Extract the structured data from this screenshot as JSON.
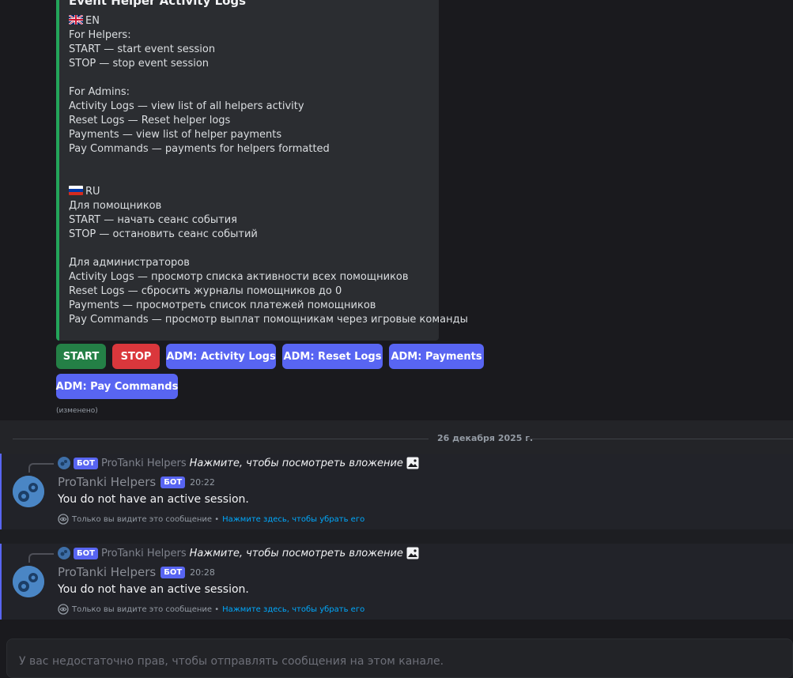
{
  "embed": {
    "title": "Event Helper Activity Logs",
    "accent_color": "#23a55a",
    "lines": [
      {
        "flag": "gb",
        "text": "EN"
      },
      {
        "text": "For Helpers:"
      },
      {
        "text": "START — start event session"
      },
      {
        "text": "STOP — stop event session"
      },
      {
        "text": ""
      },
      {
        "text": "For Admins:"
      },
      {
        "text": "Activity Logs — view list of all helpers activity"
      },
      {
        "text": "Reset Logs — Reset helper logs"
      },
      {
        "text": "Payments — view list of helper payments"
      },
      {
        "text": "Pay Commands — payments for helpers formatted"
      },
      {
        "text": ""
      },
      {
        "text": ""
      },
      {
        "flag": "ru",
        "text": "RU"
      },
      {
        "text": "Для помощников"
      },
      {
        "text": "START — начать сеанс события"
      },
      {
        "text": "STOP — остановить сеанс событий"
      },
      {
        "text": ""
      },
      {
        "text": "Для администраторов"
      },
      {
        "text": "Activity Logs — просмотр списка активности всех помощников"
      },
      {
        "text": "Reset Logs — сбросить журналы помощников до 0"
      },
      {
        "text": "Payments — просмотреть список платежей помощников"
      },
      {
        "text": "Pay Commands — просмотр выплат помощникам через игровые команды"
      }
    ]
  },
  "buttons": {
    "start": "START",
    "stop": "STOP",
    "activity_logs": "ADM: Activity Logs",
    "reset_logs": "ADM: Reset Logs",
    "payments": "ADM: Payments",
    "pay_commands": "ADM: Pay Commands"
  },
  "edited_label": "(изменено)",
  "date_divider": "26 декабря 2025 г.",
  "messages": [
    {
      "reply_bot_tag": "БОТ",
      "reply_author": "ProTanki Helpers",
      "reply_text": "Нажмите, чтобы посмотреть вложение",
      "author": "ProTanki Helpers",
      "bot_tag": "БОТ",
      "time": "20:22",
      "content": "You do not have an active session.",
      "ephemeral_note": "Только вы видите это сообщение •",
      "dismiss_link": "Нажмите здесь, чтобы убрать его"
    },
    {
      "reply_bot_tag": "БОТ",
      "reply_author": "ProTanki Helpers",
      "reply_text": "Нажмите, чтобы посмотреть вложение",
      "author": "ProTanki Helpers",
      "bot_tag": "БОТ",
      "time": "20:28",
      "content": "You do not have an active session.",
      "ephemeral_note": "Только вы видите это сообщение •",
      "dismiss_link": "Нажмите здесь, чтобы убрать его"
    }
  ],
  "input": {
    "placeholder": "У вас недостаточно прав, чтобы отправлять сообщения на этом канале."
  },
  "colors": {
    "background": "#1a1a1e",
    "embed_bg": "#2b2d31",
    "button_green": "#248046",
    "button_red": "#da373c",
    "button_blurple": "#5865f2",
    "link": "#00a8fc"
  }
}
